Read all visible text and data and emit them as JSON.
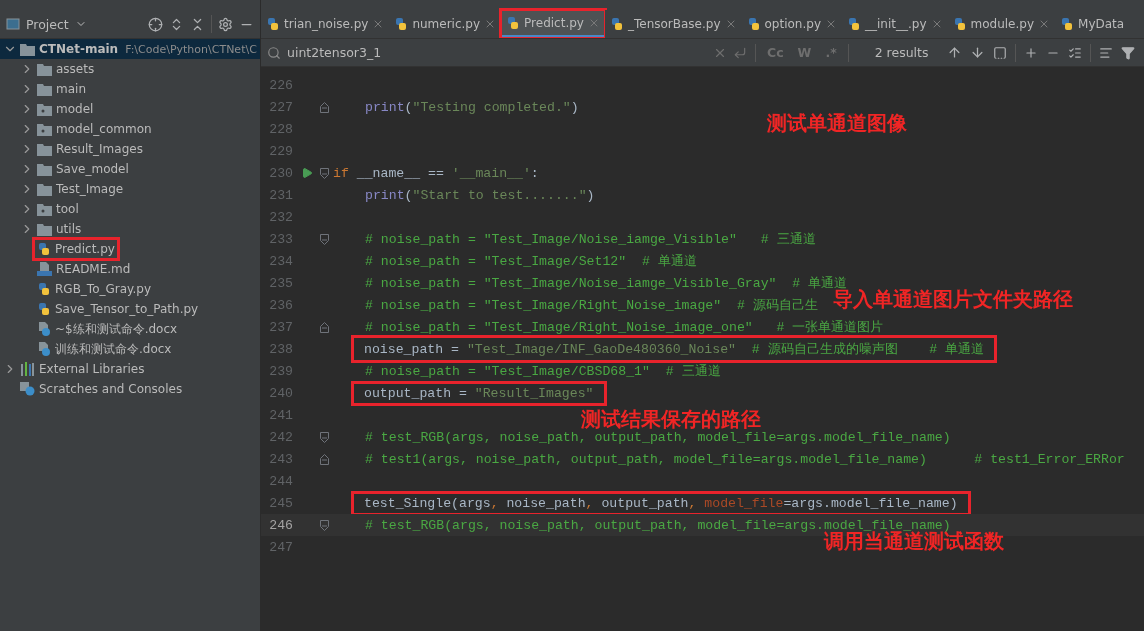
{
  "sidebar": {
    "title": "Project",
    "tree": [
      {
        "label": "CTNet-main",
        "path": "F:\\Code\\Python\\CTNet\\C",
        "kind": "project",
        "expanded": true,
        "selected": true,
        "highlighted": false,
        "children": [
          {
            "label": "assets",
            "kind": "folder",
            "expanded": false,
            "selected": false,
            "highlighted": false
          },
          {
            "label": "main",
            "kind": "folder",
            "expanded": false,
            "selected": false,
            "highlighted": false
          },
          {
            "label": "model",
            "kind": "package",
            "expanded": false,
            "selected": false,
            "highlighted": false
          },
          {
            "label": "model_common",
            "kind": "package",
            "expanded": false,
            "selected": false,
            "highlighted": false
          },
          {
            "label": "Result_Images",
            "kind": "folder",
            "expanded": false,
            "selected": false,
            "highlighted": false
          },
          {
            "label": "Save_model",
            "kind": "folder",
            "expanded": false,
            "selected": false,
            "highlighted": false
          },
          {
            "label": "Test_Image",
            "kind": "folder",
            "expanded": false,
            "selected": false,
            "highlighted": false
          },
          {
            "label": "tool",
            "kind": "package",
            "expanded": false,
            "selected": false,
            "highlighted": false
          },
          {
            "label": "utils",
            "kind": "folder",
            "expanded": false,
            "selected": false,
            "highlighted": false
          },
          {
            "label": "Predict.py",
            "kind": "python",
            "selected": false,
            "highlighted": true
          },
          {
            "label": "README.md",
            "kind": "markdown",
            "selected": false,
            "highlighted": false
          },
          {
            "label": "RGB_To_Gray.py",
            "kind": "python",
            "selected": false,
            "highlighted": false
          },
          {
            "label": "Save_Tensor_to_Path.py",
            "kind": "python",
            "selected": false,
            "highlighted": false
          },
          {
            "label": "~$练和测试命令.docx",
            "kind": "document",
            "selected": false,
            "highlighted": false
          },
          {
            "label": "训练和测试命令.docx",
            "kind": "document",
            "selected": false,
            "highlighted": false
          }
        ]
      },
      {
        "label": "External Libraries",
        "kind": "library",
        "expanded": false,
        "selected": false,
        "highlighted": false
      },
      {
        "label": "Scratches and Consoles",
        "kind": "scratches",
        "selected": false,
        "highlighted": false
      }
    ]
  },
  "tabs": [
    {
      "label": "trian_noise.py",
      "selected": false,
      "highlighted": false,
      "closable": true
    },
    {
      "label": "numeric.py",
      "selected": false,
      "highlighted": false,
      "closable": true
    },
    {
      "label": "Predict.py",
      "selected": true,
      "highlighted": true,
      "closable": true
    },
    {
      "label": "_TensorBase.py",
      "selected": false,
      "highlighted": false,
      "closable": true
    },
    {
      "label": "option.py",
      "selected": false,
      "highlighted": false,
      "closable": true
    },
    {
      "label": "__init__.py",
      "selected": false,
      "highlighted": false,
      "closable": true
    },
    {
      "label": "module.py",
      "selected": false,
      "highlighted": false,
      "closable": true
    },
    {
      "label": "MyData",
      "selected": false,
      "highlighted": false,
      "closable": false
    }
  ],
  "search": {
    "value": "uint2tensor3_1",
    "options": [
      "Cc",
      "W",
      ".*"
    ],
    "results": "2 results"
  },
  "editor": {
    "lines": [
      {
        "number": "226",
        "current": false
      },
      {
        "number": "227",
        "current": false,
        "highlighted": false,
        "fold_close": true,
        "indented": true,
        "segments": [
          {
            "kind": "builtin",
            "t": "print"
          },
          {
            "kind": "plain",
            "t": "("
          },
          {
            "kind": "str",
            "t": "\"Testing completed.\""
          },
          {
            "kind": "plain",
            "t": ")"
          }
        ]
      },
      {
        "number": "228",
        "current": false,
        "note": "测试单通道图像"
      },
      {
        "number": "229",
        "current": false
      },
      {
        "number": "230",
        "current": false,
        "highlighted": false,
        "run": true,
        "fold_open": true,
        "segments": [
          {
            "kind": "kw",
            "t": "if"
          },
          {
            "kind": "plain",
            "t": " __name__ == "
          },
          {
            "kind": "str",
            "t": "'__main__'"
          },
          {
            "kind": "plain",
            "t": ":"
          }
        ]
      },
      {
        "number": "231",
        "current": false,
        "highlighted": false,
        "indented": true,
        "segments": [
          {
            "kind": "builtin",
            "t": "print"
          },
          {
            "kind": "plain",
            "t": "("
          },
          {
            "kind": "str",
            "t": "\"Start to test.......\""
          },
          {
            "kind": "plain",
            "t": ")"
          }
        ]
      },
      {
        "number": "232",
        "current": false
      },
      {
        "number": "233",
        "current": false,
        "highlighted": false,
        "fold_open": true,
        "indented": true,
        "segments": [
          {
            "kind": "comment",
            "t": "# noise_path = \"Test_Image/Noise_iamge_Visible\"   # 三通道"
          }
        ]
      },
      {
        "number": "234",
        "current": false,
        "highlighted": false,
        "indented": true,
        "segments": [
          {
            "kind": "comment",
            "t": "# noise_path = \"Test_Image/Set12\"  # 单通道"
          }
        ]
      },
      {
        "number": "235",
        "current": false,
        "highlighted": false,
        "indented": true,
        "segments": [
          {
            "kind": "comment",
            "t": "# noise_path = \"Test_Image/Noise_iamge_Visible_Gray\"  # 单通道"
          }
        ]
      },
      {
        "number": "236",
        "current": false,
        "highlighted": false,
        "indented": true,
        "segments": [
          {
            "kind": "comment",
            "t": "# noise_path = \"Test_Image/Right_Noise_image\"  # 源码自己生"
          }
        ],
        "note": "导入单通道图片文件夹路径"
      },
      {
        "number": "237",
        "current": false,
        "highlighted": false,
        "fold_close": true,
        "indented": true,
        "segments": [
          {
            "kind": "comment",
            "t": "# noise_path = \"Test_Image/Right_Noise_image_one\"   # 一张单通道图片"
          }
        ]
      },
      {
        "number": "238",
        "current": false,
        "highlighted": true,
        "indented": true,
        "segments": [
          {
            "kind": "plain",
            "t": "noise_path = "
          },
          {
            "kind": "str",
            "t": "\"Test_Image/INF_GaoDe480360_Noise\""
          },
          {
            "kind": "comment",
            "t": "  # 源码自己生成的噪声图    # 单通道"
          }
        ]
      },
      {
        "number": "239",
        "current": false,
        "highlighted": false,
        "indented": true,
        "segments": [
          {
            "kind": "comment",
            "t": "# noise_path = \"Test_Image/CBSD68_1\"  # 三通道"
          }
        ]
      },
      {
        "number": "240",
        "current": false,
        "highlighted": true,
        "indented": true,
        "segments": [
          {
            "kind": "plain",
            "t": "output_path = "
          },
          {
            "kind": "str",
            "t": "\"Result_Images\""
          }
        ]
      },
      {
        "number": "241",
        "current": false,
        "note": "测试结果保存的路径"
      },
      {
        "number": "242",
        "current": false,
        "highlighted": false,
        "fold_open": true,
        "indented": true,
        "segments": [
          {
            "kind": "comment",
            "t": "# test_RGB(args, noise_path, output_path, model_file=args.model_file_name)"
          }
        ]
      },
      {
        "number": "243",
        "current": false,
        "highlighted": false,
        "fold_close": true,
        "indented": true,
        "segments": [
          {
            "kind": "comment",
            "t": "# test1(args, noise_path, output_path, model_file=args.model_file_name)      # test1_Error_ERRor"
          }
        ]
      },
      {
        "number": "244",
        "current": false
      },
      {
        "number": "245",
        "current": false,
        "highlighted": true,
        "indented": true,
        "segments": [
          {
            "kind": "plain",
            "t": "test_Single(args"
          },
          {
            "kind": "kw",
            "t": ", "
          },
          {
            "kind": "plain",
            "t": "noise_path"
          },
          {
            "kind": "kw",
            "t": ", "
          },
          {
            "kind": "plain",
            "t": "output_path"
          },
          {
            "kind": "kw",
            "t": ", "
          },
          {
            "kind": "param",
            "t": "model_file"
          },
          {
            "kind": "plain",
            "t": "=args.model_file_name)"
          }
        ]
      },
      {
        "number": "246",
        "current": true,
        "highlighted": false,
        "fold_open": true,
        "indented": true,
        "segments": [
          {
            "kind": "comment",
            "t": "# test_RGB(args, noise_path, output_path, model_file=args.model_file_name)"
          }
        ]
      },
      {
        "number": "247",
        "current": false,
        "note": "调用当通道测试函数"
      }
    ]
  }
}
